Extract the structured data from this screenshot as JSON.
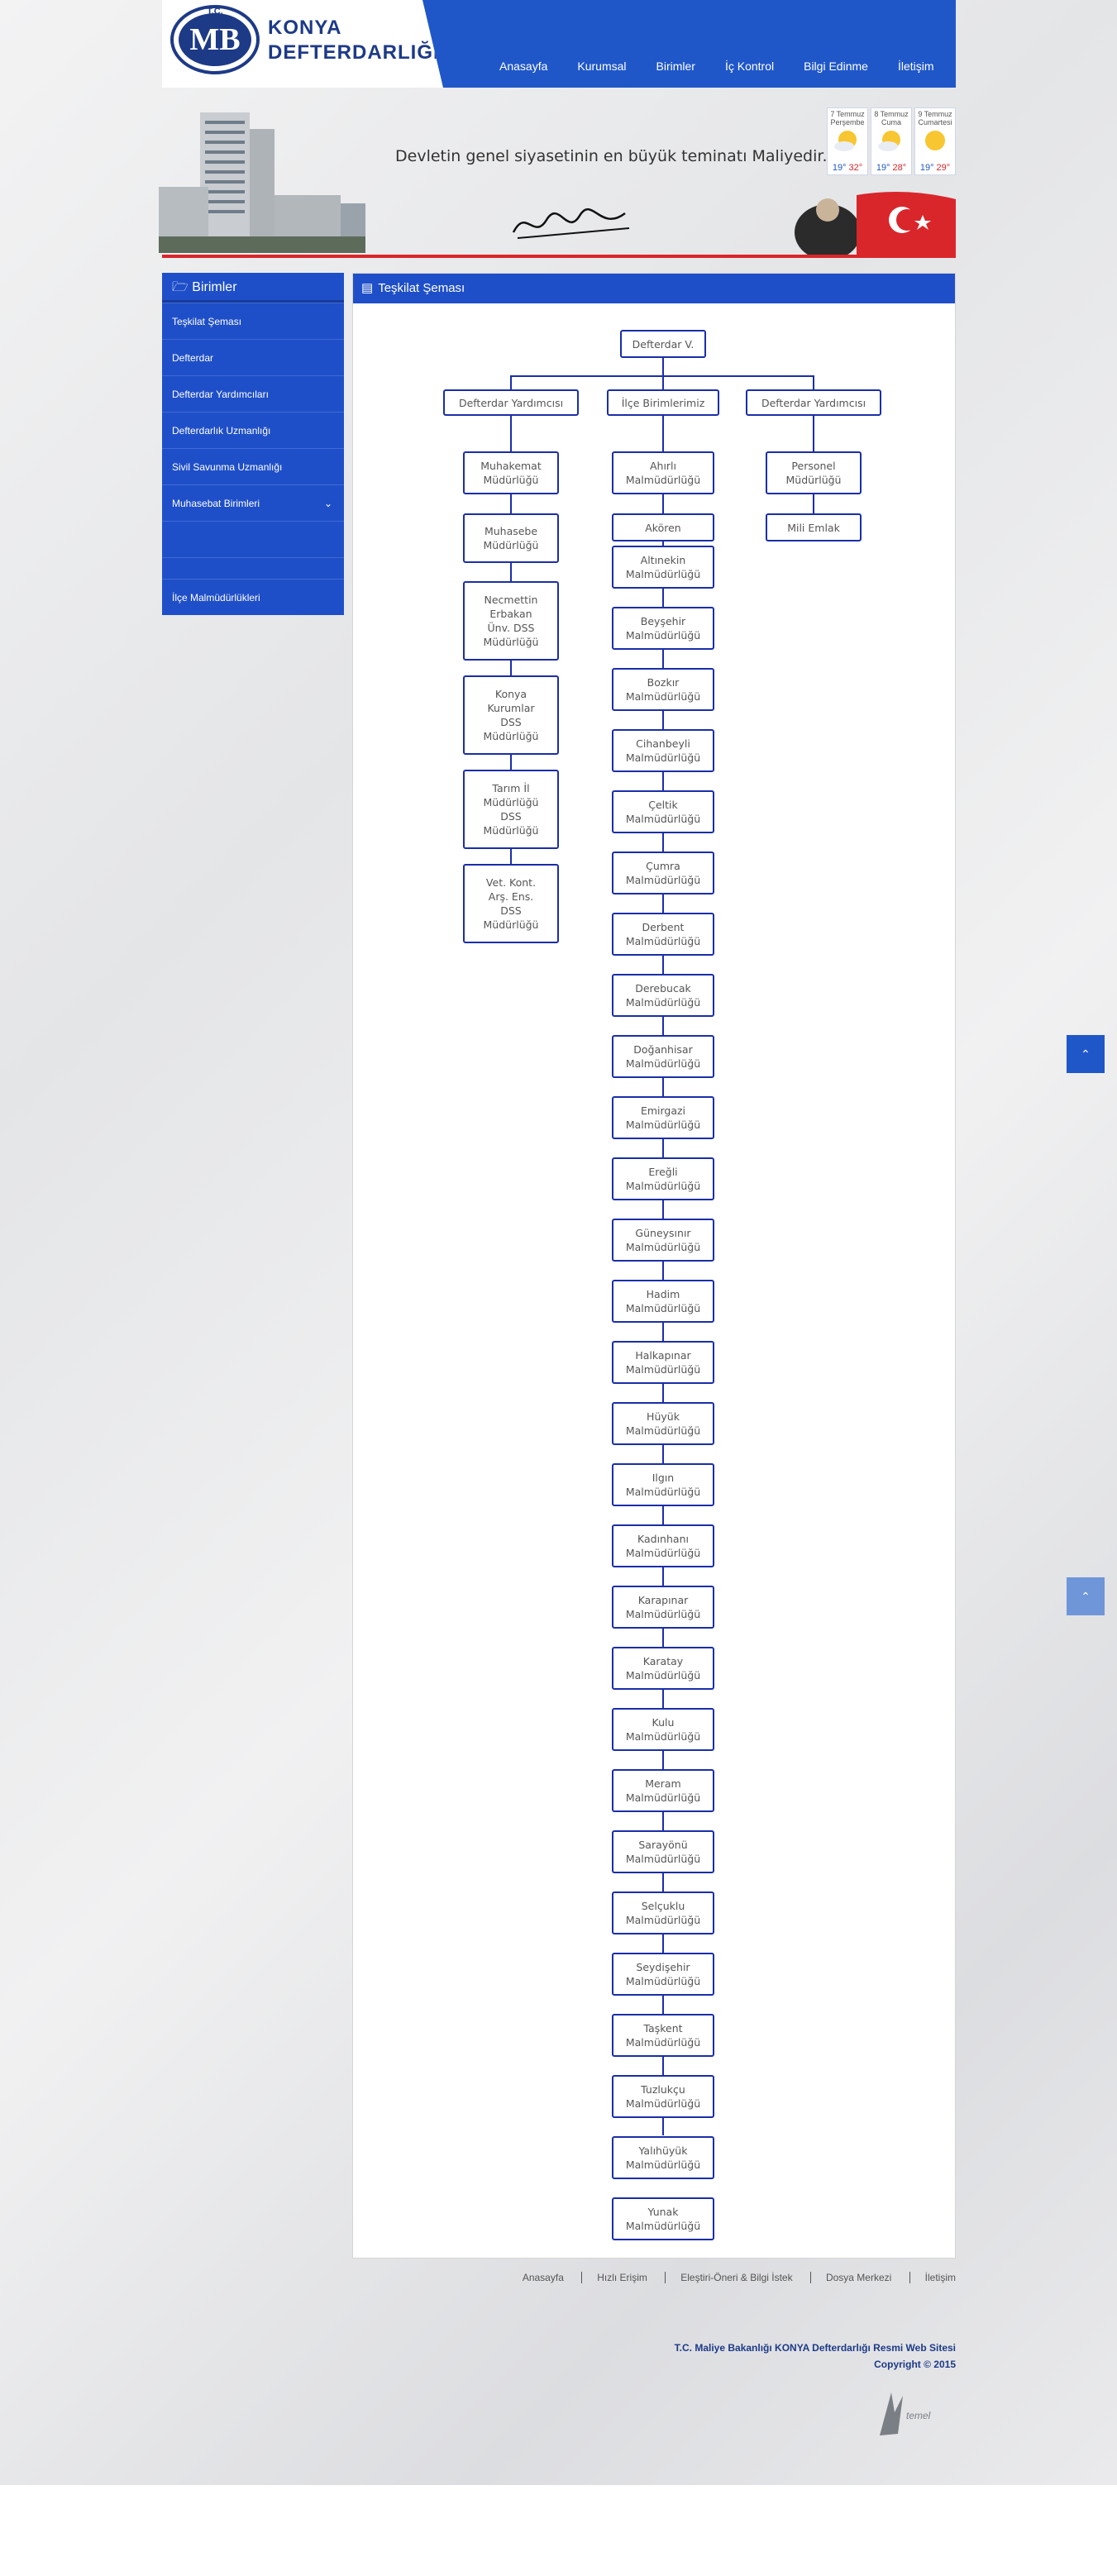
{
  "header": {
    "logo_text": "MB",
    "logo_top": "T.C.",
    "logo_bottom": "MALİYE BAKANLIĞI",
    "brand_line1": "KONYA",
    "brand_line2": "DEFTERDARLIĞI",
    "nav": [
      "Anasayfa",
      "Kurumsal",
      "Birimler",
      "İç Kontrol",
      "Bilgi Edinme",
      "İletişim"
    ]
  },
  "banner": {
    "quote": "Devletin genel siyasetinin en büyük teminatı Maliyedir.",
    "weather": [
      {
        "day": "7 Temmuz\nPerşembe",
        "lo": "19°",
        "hi": "32°"
      },
      {
        "day": "8 Temmuz\nCuma",
        "lo": "19°",
        "hi": "28°"
      },
      {
        "day": "9 Temmuz\nCumartesi",
        "lo": "19°",
        "hi": "29°"
      }
    ]
  },
  "sidebar": {
    "title": "Birimler",
    "items": [
      "Teşkilat Şeması",
      "Defterdar",
      "Defterdar Yardımcıları",
      "Defterdarlık Uzmanlığı",
      "Sivil Savunma Uzmanlığı",
      "Muhasebat Birimleri",
      "",
      "İlçe Malmüdürlükleri"
    ]
  },
  "main": {
    "title": "Teşkilat Şeması"
  },
  "org": {
    "root": "Defterdar V.",
    "level2": [
      "Defterdar Yardımcısı",
      "İlçe Birimlerimiz",
      "Defterdar Yardımcısı"
    ],
    "left": [
      "Muhakemat\nMüdürlüğü",
      "Muhasebe\nMüdürlüğü",
      "Necmettin\nErbakan\nÜnv. DSS\nMüdürlüğü",
      "Konya\nKurumlar\nDSS\nMüdürlüğü",
      "Tarım İl\nMüdürlüğü\nDSS\nMüdürlüğü",
      "Vet. Kont.\nArş. Ens.\nDSS\nMüdürlüğü"
    ],
    "center": [
      "Ahırlı\nMalmüdürlüğü",
      "Akören",
      "Altınekin\nMalmüdürlüğü",
      "Beyşehir\nMalmüdürlüğü",
      "Bozkır\nMalmüdürlüğü",
      "Cihanbeyli\nMalmüdürlüğü",
      "Çeltik\nMalmüdürlüğü",
      "Çumra\nMalmüdürlüğü",
      "Derbent\nMalmüdürlüğü",
      "Derebucak\nMalmüdürlüğü",
      "Doğanhisar\nMalmüdürlüğü",
      "Emirgazi\nMalmüdürlüğü",
      "Ereğli\nMalmüdürlüğü",
      "Güneysınır\nMalmüdürlüğü",
      "Hadim\nMalmüdürlüğü",
      "Halkapınar\nMalmüdürlüğü",
      "Hüyük\nMalmüdürlüğü",
      "Ilgın\nMalmüdürlüğü",
      "Kadınhanı\nMalmüdürlüğü",
      "Karapınar\nMalmüdürlüğü",
      "Karatay\nMalmüdürlüğü",
      "Kulu\nMalmüdürlüğü",
      "Meram\nMalmüdürlüğü",
      "Sarayönü\nMalmüdürlüğü",
      "Selçuklu\nMalmüdürlüğü",
      "Seydişehir\nMalmüdürlüğü",
      "Taşkent\nMalmüdürlüğü",
      "Tuzlukçu\nMalmüdürlüğü",
      "Yalıhüyük\nMalmüdürlüğü",
      "Yunak\nMalmüdürlüğü"
    ],
    "right": [
      "Personel\nMüdürlüğü",
      "Mili Emlak"
    ]
  },
  "footer": {
    "links": [
      "Anasayfa",
      "Hızlı Erişim",
      "Eleştiri-Öneri & Bilgi İstek",
      "Dosya Merkezi",
      "İletişim"
    ],
    "copyright1": "T.C. Maliye Bakanlığı KONYA Defterdarlığı Resmi Web Sitesi",
    "copyright2": "Copyright © 2015",
    "maker": "temel"
  },
  "colors": {
    "primary": "#1f4fc8",
    "accent_red": "#d9262b",
    "node_border": "#1a2ea8"
  }
}
